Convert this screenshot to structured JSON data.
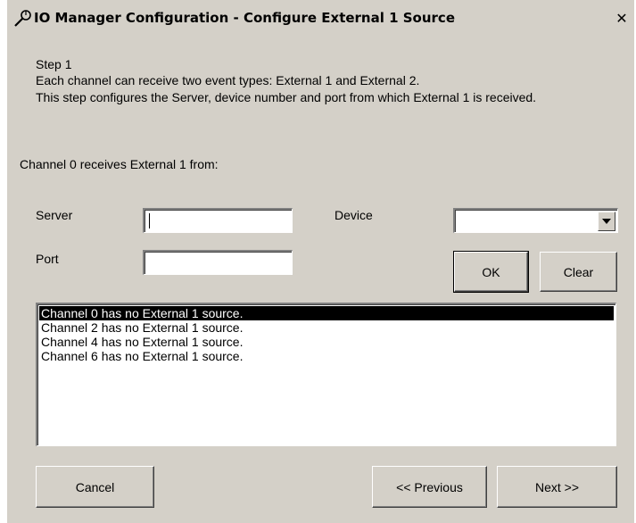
{
  "window": {
    "title": "IO Manager Configuration - Configure External 1 Source",
    "close_glyph": "✕"
  },
  "intro": {
    "step": "Step 1",
    "line1": "Each channel can receive two event types: External 1 and External 2.",
    "line2": "This step configures the Server, device number and port from which External 1 is received."
  },
  "channel_heading": "Channel 0 receives External 1 from:",
  "form": {
    "server_label": "Server",
    "server_value": "",
    "device_label": "Device",
    "device_value": "",
    "port_label": "Port",
    "port_value": ""
  },
  "buttons": {
    "ok": "OK",
    "clear": "Clear",
    "cancel": "Cancel",
    "previous": "<< Previous",
    "next": "Next >>"
  },
  "list": {
    "items": [
      "Channel 0 has no External 1 source.",
      "Channel 2 has no External 1 source.",
      "Channel 4 has no External 1 source.",
      "Channel 6 has no External 1 source."
    ],
    "selected_index": 0
  },
  "icons": {
    "title": "tools-icon",
    "close": "close-icon",
    "dropdown": "chevron-down-icon"
  },
  "colors": {
    "face": "#d4d0c8",
    "selection": "#000000"
  }
}
